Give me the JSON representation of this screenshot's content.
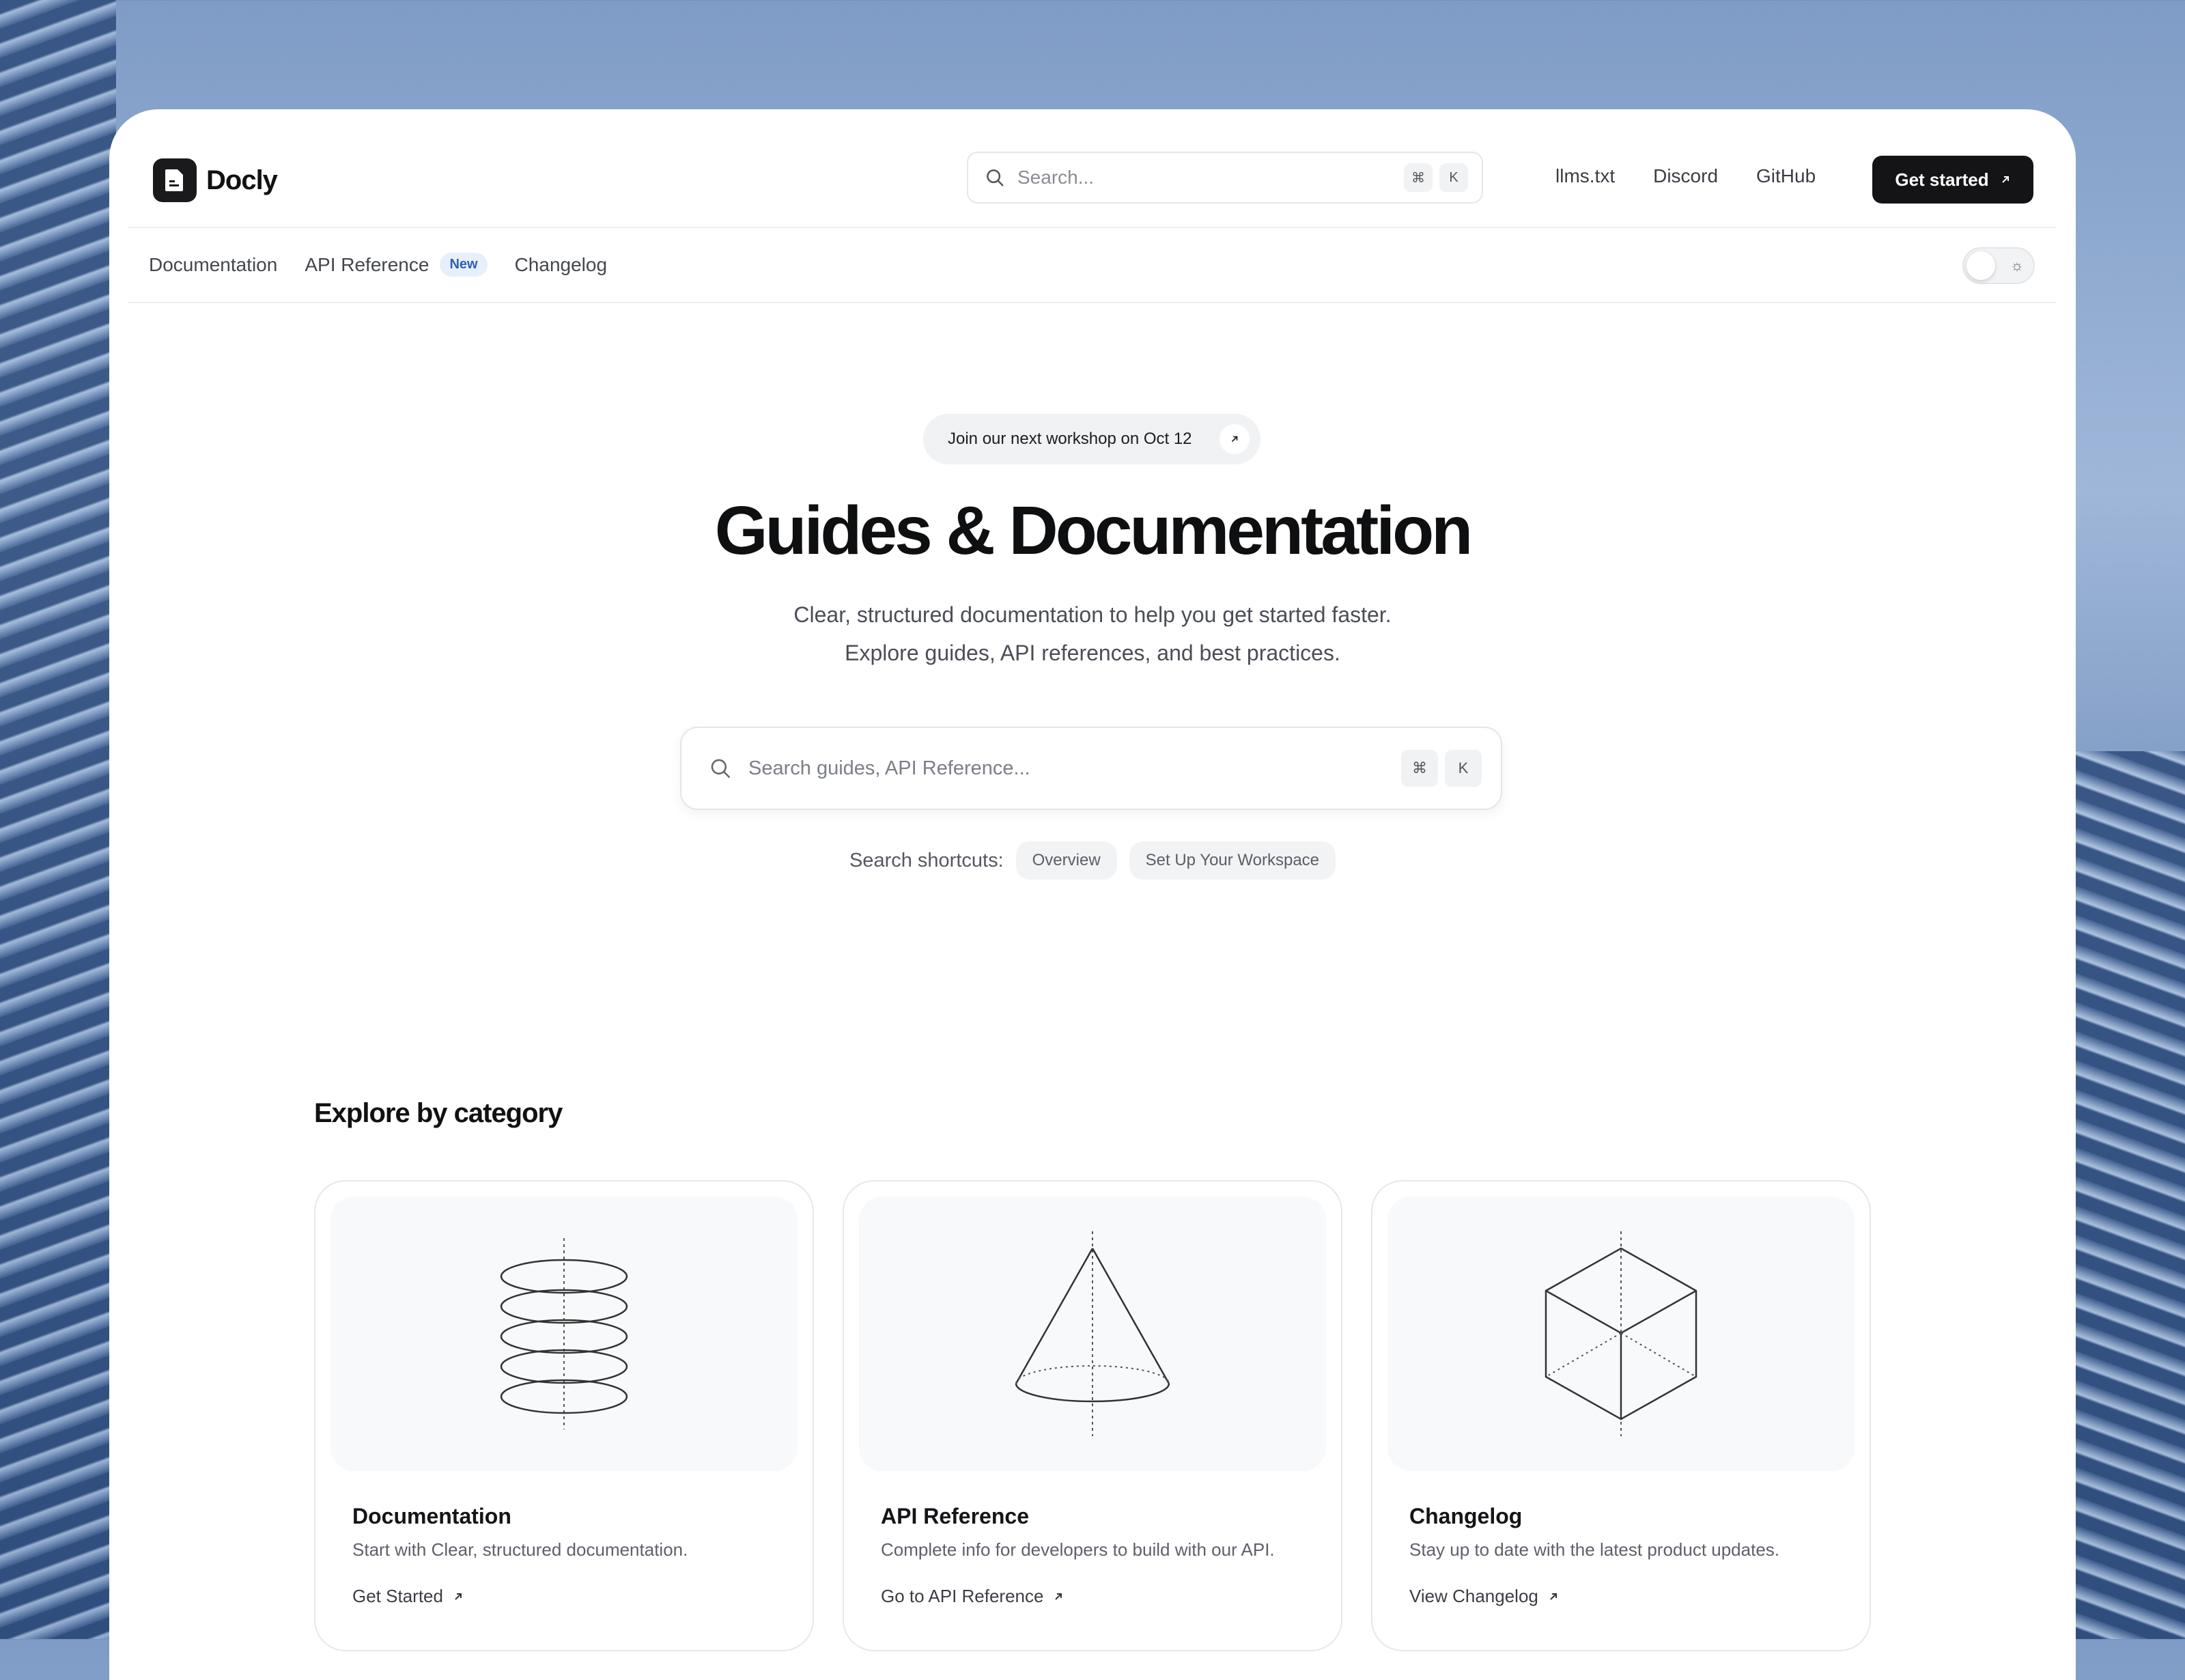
{
  "header": {
    "brand": "Docly",
    "search_placeholder": "Search...",
    "kbd_cmd": "⌘",
    "kbd_k": "K",
    "links": [
      "llms.txt",
      "Discord",
      "GitHub"
    ],
    "cta": "Get started"
  },
  "subnav": {
    "items": [
      "Documentation",
      "API Reference",
      "Changelog"
    ],
    "badge": "New"
  },
  "hero": {
    "pill": "Join our next workshop on Oct 12",
    "title": "Guides & Documentation",
    "subtitle_line1": "Clear, structured documentation to help you get started faster.",
    "subtitle_line2": "Explore guides, API references, and best practices.",
    "search_placeholder": "Search guides, API Reference...",
    "shortcuts_label": "Search shortcuts:",
    "shortcuts": [
      "Overview",
      "Set Up Your Workspace"
    ]
  },
  "explore": {
    "title": "Explore by category",
    "cards": [
      {
        "title": "Documentation",
        "desc": "Start with Clear, structured documentation.",
        "link": "Get Started",
        "icon": "stacked-rings-icon"
      },
      {
        "title": "API Reference",
        "desc": "Complete info for developers to build with our API.",
        "link": "Go to API Reference",
        "icon": "cone-icon"
      },
      {
        "title": "Changelog",
        "desc": "Stay up to date with the latest product updates.",
        "link": "View Changelog",
        "icon": "cube-icon"
      }
    ]
  },
  "colors": {
    "cta_bg": "#141416",
    "badge_bg": "#e7effb",
    "badge_text": "#2f5fb3"
  }
}
